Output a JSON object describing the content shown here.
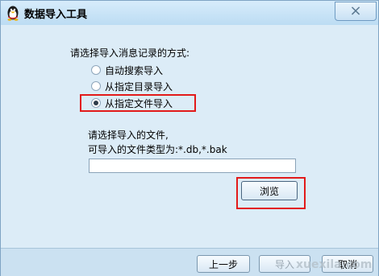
{
  "window": {
    "title": "数据导入工具",
    "close_glyph": "×",
    "icon": "qq-penguin-icon"
  },
  "main": {
    "prompt": "请选择导入消息记录的方式:",
    "options": [
      {
        "label": "自动搜索导入",
        "checked": false
      },
      {
        "label": "从指定目录导入",
        "checked": false
      },
      {
        "label": "从指定文件导入",
        "checked": true
      }
    ],
    "file_hint_line1": "请选择导入的文件,",
    "file_hint_line2": "可导入的文件类型为:*.db,*.bak",
    "file_path_value": "",
    "browse_label": "浏览"
  },
  "footer": {
    "prev_label": "上一步",
    "import_label": "导入",
    "cancel_label": "取消"
  },
  "watermark": "xuexila.com",
  "colors": {
    "highlight": "#e21a1a",
    "background": "#dcecf7"
  }
}
